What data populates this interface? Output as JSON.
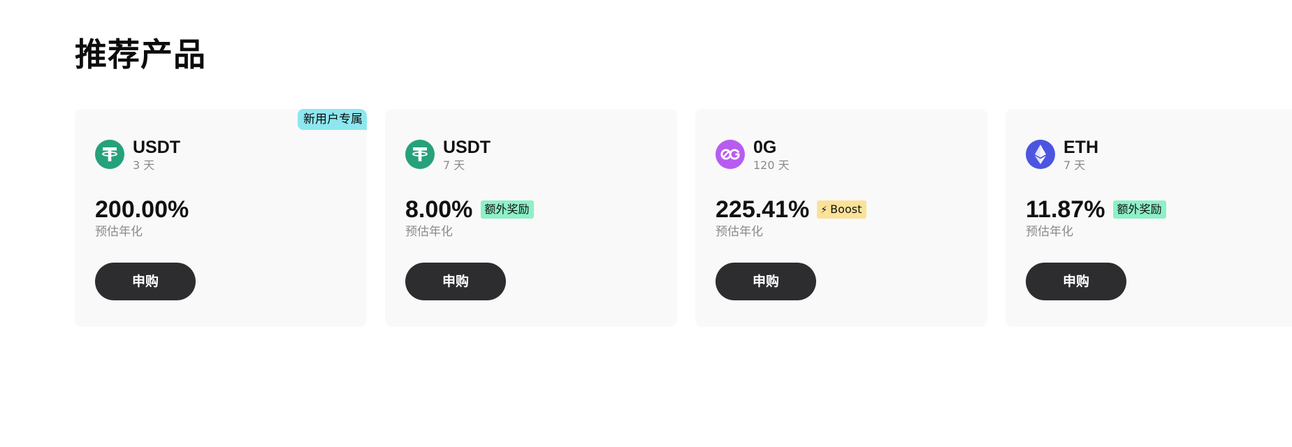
{
  "section": {
    "title": "推荐产品"
  },
  "products": [
    {
      "token": "USDT",
      "term": "3 天",
      "icon": "usdt-icon",
      "icon_color": "#26A17B",
      "rate": "200.00%",
      "rate_label": "预估年化",
      "corner_tag": "新用户专属",
      "tag": "",
      "button": "申购"
    },
    {
      "token": "USDT",
      "term": "7 天",
      "icon": "usdt-icon",
      "icon_color": "#26A17B",
      "rate": "8.00%",
      "rate_label": "预估年化",
      "corner_tag": "",
      "tag": "额外奖励",
      "button": "申购"
    },
    {
      "token": "0G",
      "term": "120 天",
      "icon": "og-icon",
      "icon_color": "#B75CF0",
      "rate": "225.41%",
      "rate_label": "预估年化",
      "corner_tag": "",
      "tag": "Boost",
      "button": "申购"
    },
    {
      "token": "ETH",
      "term": "7 天",
      "icon": "eth-icon",
      "icon_color": "#4B55E0",
      "rate": "11.87%",
      "rate_label": "预估年化",
      "corner_tag": "",
      "tag": "额外奖励",
      "button": "申购"
    }
  ],
  "colors": {
    "card_bg": "#F9F9F9",
    "button_bg": "#2D2D30",
    "reward_tag": "#8EF0C8",
    "boost_tag": "#FBE29A",
    "new_user_tag": "#8DE7EF"
  }
}
